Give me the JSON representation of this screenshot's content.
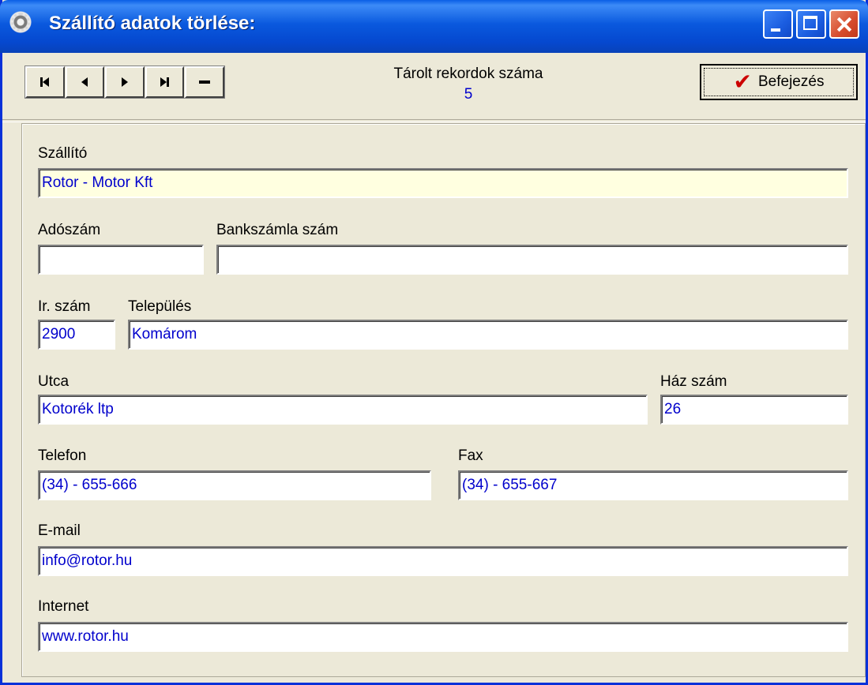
{
  "window": {
    "title": "Szállító adatok törlése:",
    "icon": "gear-icon"
  },
  "toolbar": {
    "nav_buttons": [
      "first-record-icon",
      "previous-record-icon",
      "next-record-icon",
      "last-record-icon",
      "delete-record-icon"
    ],
    "records_label": "Tárolt rekordok száma",
    "records_count": "5",
    "finish_label": "Befejezés"
  },
  "form": {
    "supplier_label": "Szállító",
    "supplier_value": "Rotor - Motor Kft",
    "tax_label": "Adószám",
    "tax_value": "",
    "bank_label": "Bankszámla szám",
    "bank_value": "",
    "zip_label": "Ir. szám",
    "zip_value": "2900",
    "city_label": "Település",
    "city_value": "Komárom",
    "street_label": "Utca",
    "street_value": "Kotorék ltp",
    "house_label": "Ház szám",
    "house_value": "26",
    "phone_label": "Telefon",
    "phone_value": "(34) - 655-666",
    "fax_label": "Fax",
    "fax_value": "(34) - 655-667",
    "email_label": "E-mail",
    "email_value": "info@rotor.hu",
    "web_label": "Internet",
    "web_value": "www.rotor.hu"
  },
  "colors": {
    "title_bar": "#0a5fe6",
    "field_text": "#0000cc",
    "highlight_field": "#ffffe0",
    "face": "#ece9d8"
  }
}
